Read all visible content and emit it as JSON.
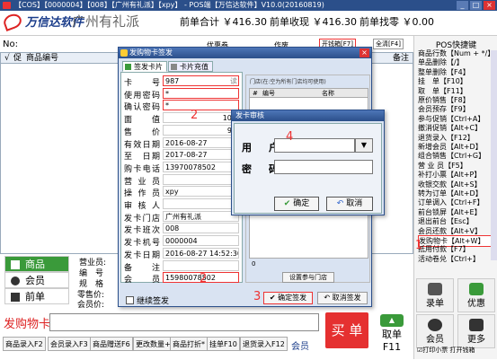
{
  "title_bar": "【COS】【0000004】【008】【广州有礼派】【xpy】 - POS端【万信达软件】V10.0(20160819)",
  "brand": "万信达软件",
  "company": "广州有礼派",
  "stats": {
    "pre_total": "前单合计 ￥416.30",
    "pre_received": "前单收现 ￥416.30",
    "pre_change": "前单找零 ￥0.00"
  },
  "no_label": "No:",
  "tabs_top": {
    "coupon": "优惠券",
    "make": "作废",
    "cashbox": "开钱箱[F7]",
    "fullscreen": "全清[F4]"
  },
  "grid": {
    "check": "√",
    "idx": "促",
    "code": "商品编号",
    "note": "备注"
  },
  "shortcuts": {
    "title": "POS快捷键",
    "items": [
      "商品行数【Num + */】",
      "单品删除【/】",
      "整单删除【F4】",
      "挂　单【F10】",
      "取　单【F11】",
      "原价销售【F8】",
      "会员预存【F9】",
      "参与促销【Ctrl+A】",
      "撤消促销【Alt+C】",
      "退货录入【F12】",
      "新增会员【Alt+D】",
      "组合销售【Ctrl+G】",
      "营 业 员【F5】",
      "补打小票【Alt+P】",
      "收银交款【Alt+S】",
      "转为订单【Alt+D】",
      "订单调入【Ctrl+F】",
      "前台锁屏【Alt+E】",
      "退出前台【Esc】",
      "会员还款【Alt+V】",
      "发购物卡【Alt+W】",
      "抵用付款【F7】",
      "活动卷兑【Ctrl+】"
    ]
  },
  "right_btns": {
    "record": "录单",
    "discount": "优惠",
    "member": "会员",
    "more": "更多"
  },
  "left_btns": {
    "goods": "商品",
    "member": "会员",
    "front": "前单"
  },
  "prodinfo": {
    "clerk": "营业员:",
    "code": "编　号",
    "spec": "规　格",
    "retail": "零售价:",
    "vip": "会员价:"
  },
  "func_label": "发购物卡",
  "buy": "买 单",
  "get": "取单",
  "get_key": "F11",
  "vip_bottom": "会员",
  "fkeys": [
    "商品录入F2",
    "会员录入F3",
    "商品赠送F6",
    "更改数量+",
    "商品打折*",
    "挂单F10",
    "退货录入F12"
  ],
  "print_cb": "打印小票",
  "open_cashbox": "打开钱箱",
  "dialog": {
    "title": "发购物卡签发",
    "tab1": "签发卡片",
    "tab2": "卡片充值",
    "fields": [
      {
        "label": "卡　号",
        "value": "987",
        "extra": "读"
      },
      {
        "label": "使用密码",
        "value": "*"
      },
      {
        "label": "确认密码",
        "value": "*"
      },
      {
        "label": "面　值",
        "value": "100"
      },
      {
        "label": "售　价",
        "value": "90"
      },
      {
        "label": "有效日期",
        "value": "2016-08-27"
      },
      {
        "label": "至　日期",
        "value": "2017-08-27"
      },
      {
        "label": "购卡电话",
        "value": "13970078502"
      },
      {
        "label": "营 业 员",
        "value": ""
      },
      {
        "label": "操 作 员",
        "value": "xpy"
      },
      {
        "label": "审 核 人",
        "value": ""
      },
      {
        "label": "发卡门店",
        "value": "广州有礼派"
      },
      {
        "label": "发卡班次",
        "value": "008"
      },
      {
        "label": "发卡机号",
        "value": "0000004"
      },
      {
        "label": "发卡日期",
        "value": "2016-08-27 14:52:30"
      },
      {
        "label": "备　注",
        "value": ""
      },
      {
        "label": "会　员",
        "value": "15980078502"
      }
    ],
    "store_title": "门店(在:空为所有门店均可使用)",
    "store_hdr_no": "#",
    "store_hdr_code": "编号",
    "store_hdr_name": "名称",
    "store_zero": "0",
    "store_set": "设置参与门店",
    "continue": "继续签发",
    "confirm": "确定签发",
    "cancel": "取消签发"
  },
  "auth": {
    "title": "发卡审核",
    "user": "用　户",
    "pw": "密　码",
    "ok": "确定",
    "cancel": "取消"
  },
  "callouts": [
    "1",
    "2",
    "2",
    "3",
    "4"
  ]
}
